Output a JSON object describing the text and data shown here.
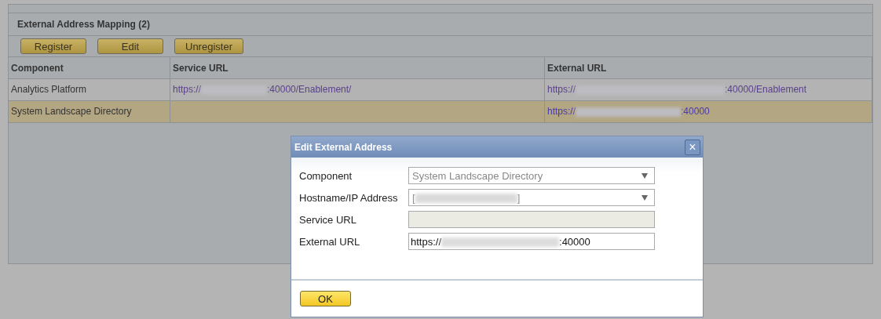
{
  "panel": {
    "title": "External Address Mapping (2)"
  },
  "toolbar": [
    {
      "label": "Register"
    },
    {
      "label": "Edit"
    },
    {
      "label": "Unregister"
    }
  ],
  "table": {
    "columns": [
      "Component",
      "Service URL",
      "External URL"
    ],
    "rows": [
      {
        "selected": false,
        "component": "Analytics Platform",
        "service_url": {
          "prefix": "https://",
          "suffix": ":40000/Enablement/"
        },
        "external_url": {
          "prefix": "https://",
          "suffix": ":40000/Enablement"
        }
      },
      {
        "selected": true,
        "component": "System Landscape Directory",
        "external_url": {
          "prefix": "https://",
          "suffix": ":40000"
        }
      }
    ]
  },
  "dialog": {
    "title": "Edit External Address",
    "close": "×",
    "fields": [
      {
        "kind": "dropdown",
        "label": "Component",
        "value": "System Landscape Directory",
        "disabled": true
      },
      {
        "kind": "dropdown",
        "label": "Hostname/IP Address",
        "value": {
          "prefix": "[",
          "suffix": "]"
        },
        "disabled": true
      },
      {
        "kind": "text",
        "label": "Service URL",
        "disabled": true
      },
      {
        "kind": "text",
        "label": "External URL",
        "value": {
          "prefix": "https://",
          "suffix": ":40000"
        },
        "disabled": false
      }
    ],
    "button": "OK"
  }
}
